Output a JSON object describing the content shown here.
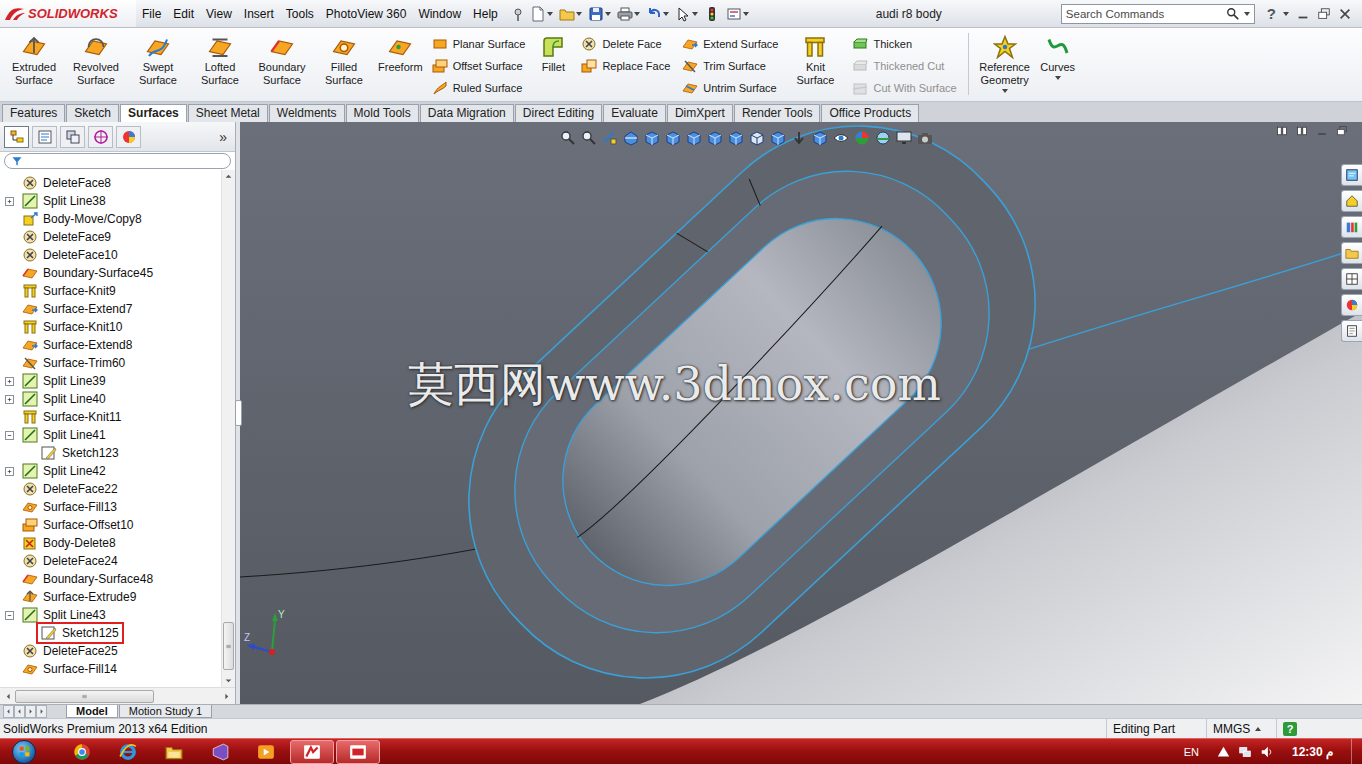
{
  "window": {
    "title": "audi r8 body"
  },
  "logo": {
    "text": "SOLIDWORKS"
  },
  "menu": [
    "File",
    "Edit",
    "View",
    "Insert",
    "Tools",
    "PhotoView 360",
    "Window",
    "Help"
  ],
  "search": {
    "placeholder": "Search Commands"
  },
  "help": "?",
  "ribbon": [
    {
      "kind": "large",
      "label": "Extruded Surface",
      "disabled": false,
      "dropdown": false
    },
    {
      "kind": "large",
      "label": "Revolved Surface",
      "disabled": false,
      "dropdown": false
    },
    {
      "kind": "large",
      "label": "Swept Surface",
      "disabled": false,
      "dropdown": false
    },
    {
      "kind": "large",
      "label": "Lofted Surface",
      "disabled": false,
      "dropdown": false
    },
    {
      "kind": "large",
      "label": "Boundary Surface",
      "disabled": false,
      "dropdown": false
    },
    {
      "kind": "large",
      "label": "Filled Surface",
      "disabled": false,
      "dropdown": false
    },
    {
      "kind": "large",
      "label": "Freeform",
      "disabled": false,
      "dropdown": false
    },
    {
      "kind": "stack",
      "items": [
        {
          "label": "Planar Surface",
          "disabled": false
        },
        {
          "label": "Offset Surface",
          "disabled": false
        },
        {
          "label": "Ruled Surface",
          "disabled": false
        }
      ]
    },
    {
      "kind": "large",
      "label": "Fillet",
      "disabled": false,
      "dropdown": false
    },
    {
      "kind": "stack",
      "items": [
        {
          "label": "Delete Face",
          "disabled": false
        },
        {
          "label": "Replace Face",
          "disabled": false
        }
      ]
    },
    {
      "kind": "stack",
      "items": [
        {
          "label": "Extend Surface",
          "disabled": false
        },
        {
          "label": "Trim Surface",
          "disabled": false
        },
        {
          "label": "Untrim Surface",
          "disabled": false
        }
      ]
    },
    {
      "kind": "large",
      "label": "Knit Surface",
      "disabled": false,
      "dropdown": false
    },
    {
      "kind": "stack",
      "items": [
        {
          "label": "Thicken",
          "disabled": false
        },
        {
          "label": "Thickened Cut",
          "disabled": true
        },
        {
          "label": "Cut With Surface",
          "disabled": true
        }
      ]
    },
    {
      "kind": "separator"
    },
    {
      "kind": "large",
      "label": "Reference Geometry",
      "disabled": false,
      "dropdown": true
    },
    {
      "kind": "large",
      "label": "Curves",
      "disabled": false,
      "dropdown": true
    }
  ],
  "tabs": [
    {
      "label": "Features",
      "selected": false
    },
    {
      "label": "Sketch",
      "selected": false
    },
    {
      "label": "Surfaces",
      "selected": true
    },
    {
      "label": "Sheet Metal",
      "selected": false
    },
    {
      "label": "Weldments",
      "selected": false
    },
    {
      "label": "Mold Tools",
      "selected": false
    },
    {
      "label": "Data Migration",
      "selected": false
    },
    {
      "label": "Direct Editing",
      "selected": false
    },
    {
      "label": "Evaluate",
      "selected": false
    },
    {
      "label": "DimXpert",
      "selected": false
    },
    {
      "label": "Render Tools",
      "selected": false
    },
    {
      "label": "Office Products",
      "selected": false
    }
  ],
  "panel_tabs": [
    {
      "selected": true
    },
    {
      "selected": false
    },
    {
      "selected": false
    },
    {
      "selected": false
    },
    {
      "selected": false
    }
  ],
  "panel_more": "»",
  "tree": [
    {
      "label": "DeleteFace8",
      "kind": "delete-face",
      "depth": 0,
      "expandable": false,
      "expanded": false,
      "highlighted": false
    },
    {
      "label": "Split Line38",
      "kind": "split-line",
      "depth": 0,
      "expandable": true,
      "expanded": false,
      "highlighted": false
    },
    {
      "label": "Body-Move/Copy8",
      "kind": "move",
      "depth": 0,
      "expandable": false,
      "expanded": false,
      "highlighted": false
    },
    {
      "label": "DeleteFace9",
      "kind": "delete-face",
      "depth": 0,
      "expandable": false,
      "expanded": false,
      "highlighted": false
    },
    {
      "label": "DeleteFace10",
      "kind": "delete-face",
      "depth": 0,
      "expandable": false,
      "expanded": false,
      "highlighted": false
    },
    {
      "label": "Boundary-Surface45",
      "kind": "boundary",
      "depth": 0,
      "expandable": false,
      "expanded": false,
      "highlighted": false
    },
    {
      "label": "Surface-Knit9",
      "kind": "knit",
      "depth": 0,
      "expandable": false,
      "expanded": false,
      "highlighted": false
    },
    {
      "label": "Surface-Extend7",
      "kind": "extend",
      "depth": 0,
      "expandable": false,
      "expanded": false,
      "highlighted": false
    },
    {
      "label": "Surface-Knit10",
      "kind": "knit",
      "depth": 0,
      "expandable": false,
      "expanded": false,
      "highlighted": false
    },
    {
      "label": "Surface-Extend8",
      "kind": "extend",
      "depth": 0,
      "expandable": false,
      "expanded": false,
      "highlighted": false
    },
    {
      "label": "Surface-Trim60",
      "kind": "trim",
      "depth": 0,
      "expandable": false,
      "expanded": false,
      "highlighted": false
    },
    {
      "label": "Split Line39",
      "kind": "split-line",
      "depth": 0,
      "expandable": true,
      "expanded": false,
      "highlighted": false
    },
    {
      "label": "Split Line40",
      "kind": "split-line",
      "depth": 0,
      "expandable": true,
      "expanded": false,
      "highlighted": false
    },
    {
      "label": "Surface-Knit11",
      "kind": "knit",
      "depth": 0,
      "expandable": false,
      "expanded": false,
      "highlighted": false
    },
    {
      "label": "Split Line41",
      "kind": "split-line",
      "depth": 0,
      "expandable": true,
      "expanded": true,
      "highlighted": false
    },
    {
      "label": "Sketch123",
      "kind": "sketch",
      "depth": 1,
      "expandable": false,
      "expanded": false,
      "highlighted": false
    },
    {
      "label": "Split Line42",
      "kind": "split-line",
      "depth": 0,
      "expandable": true,
      "expanded": false,
      "highlighted": false
    },
    {
      "label": "DeleteFace22",
      "kind": "delete-face",
      "depth": 0,
      "expandable": false,
      "expanded": false,
      "highlighted": false
    },
    {
      "label": "Surface-Fill13",
      "kind": "fill",
      "depth": 0,
      "expandable": false,
      "expanded": false,
      "highlighted": false
    },
    {
      "label": "Surface-Offset10",
      "kind": "offset",
      "depth": 0,
      "expandable": false,
      "expanded": false,
      "highlighted": false
    },
    {
      "label": "Body-Delete8",
      "kind": "body-delete",
      "depth": 0,
      "expandable": false,
      "expanded": false,
      "highlighted": false
    },
    {
      "label": "DeleteFace24",
      "kind": "delete-face",
      "depth": 0,
      "expandable": false,
      "expanded": false,
      "highlighted": false
    },
    {
      "label": "Boundary-Surface48",
      "kind": "boundary",
      "depth": 0,
      "expandable": false,
      "expanded": false,
      "highlighted": false
    },
    {
      "label": "Surface-Extrude9",
      "kind": "extrude",
      "depth": 0,
      "expandable": false,
      "expanded": false,
      "highlighted": false
    },
    {
      "label": "Split Line43",
      "kind": "split-line",
      "depth": 0,
      "expandable": true,
      "expanded": true,
      "highlighted": false
    },
    {
      "label": "Sketch125",
      "kind": "sketch",
      "depth": 1,
      "expandable": false,
      "expanded": false,
      "highlighted": true
    },
    {
      "label": "DeleteFace25",
      "kind": "delete-face",
      "depth": 0,
      "expandable": false,
      "expanded": false,
      "highlighted": false
    },
    {
      "label": "Surface-Fill14",
      "kind": "fill",
      "depth": 0,
      "expandable": false,
      "expanded": false,
      "highlighted": false
    }
  ],
  "viewport": {
    "watermark": "莫西网www.3dmox.com",
    "triad": {
      "y": "Y",
      "z": "Z"
    }
  },
  "bottom_tabs": [
    {
      "label": "Model",
      "selected": true
    },
    {
      "label": "Motion Study 1",
      "selected": false
    }
  ],
  "status_bar": {
    "product": "SolidWorks Premium 2013 x64 Edition",
    "mode": "Editing Part",
    "units": "MMGS",
    "help": "?"
  },
  "taskbar": {
    "apps": [
      {
        "active": false
      },
      {
        "active": false
      },
      {
        "active": false
      },
      {
        "active": false
      },
      {
        "active": false
      },
      {
        "active": true
      },
      {
        "active": true
      }
    ],
    "language": "EN",
    "time": "12:30 م"
  }
}
